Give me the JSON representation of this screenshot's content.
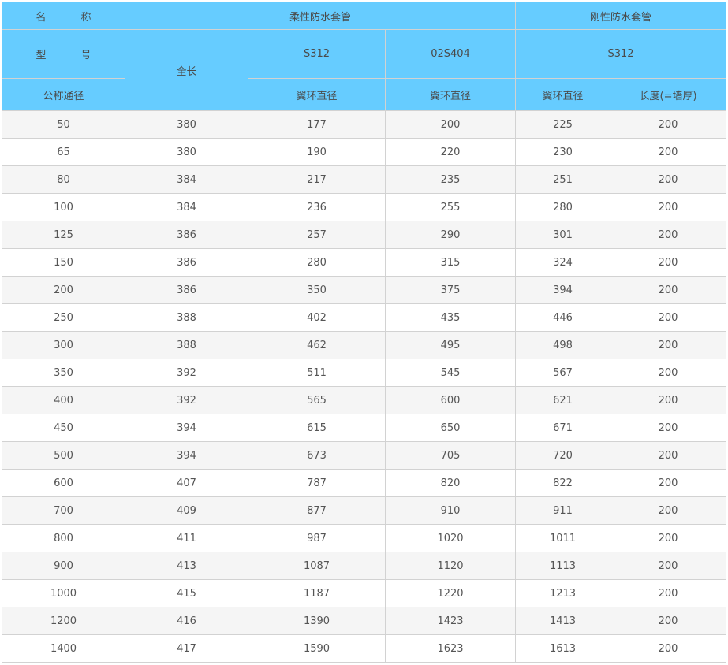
{
  "header": {
    "name_label_left": "名",
    "name_label_right": "称",
    "flexible_group": "柔性防水套管",
    "rigid_group": "刚性防水套管",
    "model_label_left": "型",
    "model_label_right": "号",
    "total_length": "全长",
    "flex_model_a": "S312",
    "flex_model_b": "02S404",
    "rigid_model": "S312",
    "nominal_diameter": "公称通径",
    "flange_diameter_a": "翼环直径",
    "flange_diameter_b": "翼环直径",
    "flange_diameter_c": "翼环直径",
    "length_wall": "长度(=墙厚)"
  },
  "rows": [
    [
      "50",
      "380",
      "177",
      "200",
      "225",
      "200"
    ],
    [
      "65",
      "380",
      "190",
      "220",
      "230",
      "200"
    ],
    [
      "80",
      "384",
      "217",
      "235",
      "251",
      "200"
    ],
    [
      "100",
      "384",
      "236",
      "255",
      "280",
      "200"
    ],
    [
      "125",
      "386",
      "257",
      "290",
      "301",
      "200"
    ],
    [
      "150",
      "386",
      "280",
      "315",
      "324",
      "200"
    ],
    [
      "200",
      "386",
      "350",
      "375",
      "394",
      "200"
    ],
    [
      "250",
      "388",
      "402",
      "435",
      "446",
      "200"
    ],
    [
      "300",
      "388",
      "462",
      "495",
      "498",
      "200"
    ],
    [
      "350",
      "392",
      "511",
      "545",
      "567",
      "200"
    ],
    [
      "400",
      "392",
      "565",
      "600",
      "621",
      "200"
    ],
    [
      "450",
      "394",
      "615",
      "650",
      "671",
      "200"
    ],
    [
      "500",
      "394",
      "673",
      "705",
      "720",
      "200"
    ],
    [
      "600",
      "407",
      "787",
      "820",
      "822",
      "200"
    ],
    [
      "700",
      "409",
      "877",
      "910",
      "911",
      "200"
    ],
    [
      "800",
      "411",
      "987",
      "1020",
      "1011",
      "200"
    ],
    [
      "900",
      "413",
      "1087",
      "1120",
      "1113",
      "200"
    ],
    [
      "1000",
      "415",
      "1187",
      "1220",
      "1213",
      "200"
    ],
    [
      "1200",
      "416",
      "1390",
      "1423",
      "1413",
      "200"
    ],
    [
      "1400",
      "417",
      "1590",
      "1623",
      "1613",
      "200"
    ]
  ],
  "colors": {
    "header_bg": "#66ccff",
    "row_alt_bg": "#f5f5f5",
    "border": "#d2d2d2"
  }
}
